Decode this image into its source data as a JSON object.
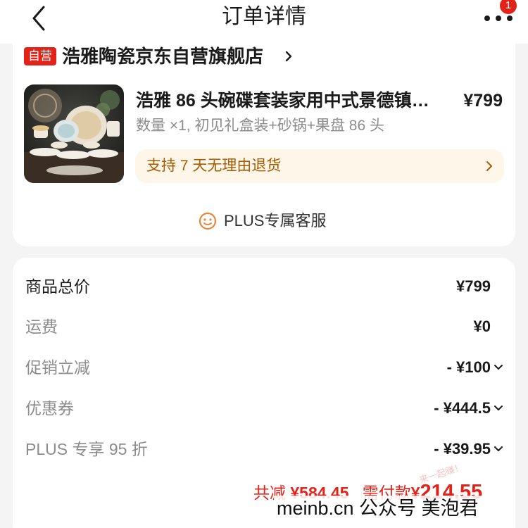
{
  "header": {
    "title": "订单详情",
    "badge_count": "1",
    "icons": {
      "back": "back-arrow-icon",
      "more": "more-dots-icon"
    }
  },
  "shop": {
    "tag": "自营",
    "name": "浩雅陶瓷京东自营旗舰店",
    "chevron_icon": "chevron-right-icon"
  },
  "product": {
    "title": "浩雅 86 头碗碟套装家用中式景德镇…",
    "price": "¥799",
    "spec": "数量 ×1, 初见礼盒装+砂锅+果盘 86 头",
    "return_policy": "支持 7 天无理由退货",
    "image_icon": "tableware-set-image"
  },
  "plus_service": {
    "label": "PLUS专属客服",
    "icon": "smiley-service-icon"
  },
  "price_rows": [
    {
      "label": "商品总价",
      "value": "¥799",
      "expandable": false
    },
    {
      "label": "运费",
      "value": "¥0",
      "expandable": false
    },
    {
      "label": "促销立减",
      "value": "- ¥100",
      "expandable": true
    },
    {
      "label": "优惠券",
      "value": "- ¥444.5",
      "expandable": true
    },
    {
      "label": "PLUS 专享 95 折",
      "value": "- ¥39.95",
      "expandable": true
    }
  ],
  "summary": {
    "saved_label": "共减",
    "saved_value": "¥584.45",
    "pay_label": "需付款",
    "pay_currency": "¥",
    "pay_value": "214.55"
  },
  "watermark": {
    "faint": "来一起赚！",
    "text": "meinb.cn 公众号 美泡君"
  },
  "colors": {
    "accent_red": "#e2231a",
    "return_bg": "#fff6ea",
    "return_text": "#a65c00",
    "plus_icon": "#e8873a"
  }
}
